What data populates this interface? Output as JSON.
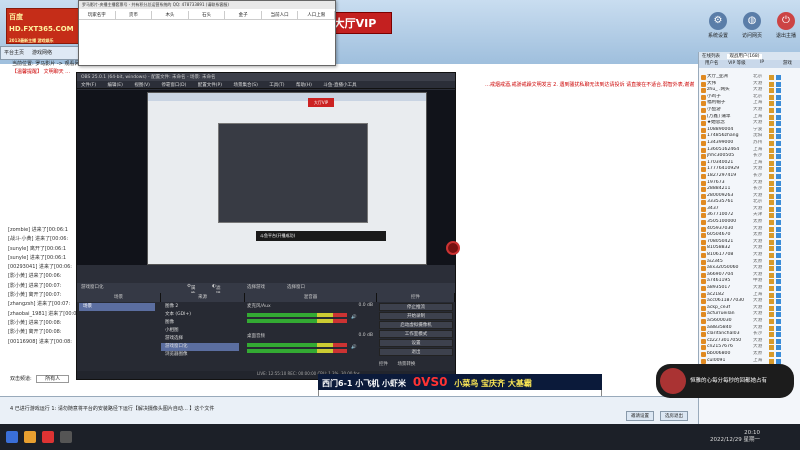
{
  "window": {
    "title": "多玩美女主播平台 4.3.0 经典版 正式版"
  },
  "logo": {
    "line1": "百度",
    "line2": "HD.FXT365.COM",
    "line3": "2013最新主播 游戏娱乐"
  },
  "header": {
    "vip_banner": "大厅VIP",
    "buttons": [
      {
        "label": "系统设置",
        "icon": "gear-icon"
      },
      {
        "label": "访问网页",
        "icon": "globe-icon"
      },
      {
        "label": "退出主播",
        "icon": "exit-icon"
      }
    ]
  },
  "left_tabs": [
    "平台主页",
    "游戏网络"
  ],
  "popup": {
    "title": "罗马影片-央播主播套票号 - 共有积分总运营系统的  QQ: 478733891 (请联系客服)",
    "columns": [
      "玩家名字",
      "货币",
      "木头",
      "石头",
      "金子",
      "当前人口",
      "人口上限"
    ]
  },
  "announcement": {
    "left": "【温馨提醒】 文明聊天 …",
    "right": "…戒烟戒酒,戒骄戒躁文明发言  2. 遇到骚扰私聊无法到达请投诉  请直接在不适合,弱智外表,谢谢"
  },
  "breadcrumb": "当前位置: 罗马影片 -> 观看网",
  "chat_log": [
    "[zombie] 进来了[00:06:1",
    "[战斗·小黄] 进来了[00:06:",
    "[sunyle] 离开了[00:06:1",
    "[sunyle] 进来了[00:06:1",
    "[00293041] 进来了[00:06:",
    "[影小黄] 进来了[00:06:",
    "[影小黄] 进来了[00:07:",
    "[影小黄] 离开了[00:07:",
    "[zhangzsh] 进来了[00:07:",
    "[zhaobai_1981] 进来了[00:08",
    "[影小黄] 进来了[00:08:",
    "[影小黄] 离开了[00:08:",
    "[00116908] 进来了[00:08:"
  ],
  "chat_input": {
    "label": "双击频道:",
    "value": "所有人"
  },
  "footer": {
    "tip": "4 已进行游戏运行   1: 请勿随意将平台的安装路径下运行【解决摄像头图片自动… 】这个文件",
    "buttons": [
      "邀请设置",
      "选房退出"
    ]
  },
  "obs": {
    "title": "OBS 25.0.1 (64-bit, windows) - 配置文件: 未命名 - 场景: 未命名",
    "menu": [
      "文件(F)",
      "编辑(E)",
      "视图(V)",
      "停靠窗口(D)",
      "配置文件(P)",
      "场景集合(S)",
      "工具(T)",
      "帮助(H)",
      "斗鱼-直播小工具"
    ],
    "preview_red": "大厅VIP",
    "preview_caption": "斗鱼平台(开播成功)",
    "controls_left": "游戏窗口化",
    "controls_items": [
      "属性",
      "滤镜",
      "选择游戏",
      "选择窗口"
    ],
    "panels": [
      "场景",
      "来源",
      "混音器",
      "控件"
    ],
    "scene": "场景",
    "sources": [
      "图像 2",
      "文本 (GDI+)",
      "图像",
      "小相图",
      "游戏选择",
      "游戏窗口化",
      "浏览器图像"
    ],
    "mixer": [
      {
        "name": "麦克风/Aux",
        "db": "0.0 dB"
      },
      {
        "name": "桌面音频",
        "db": "0.0 dB"
      }
    ],
    "controls": [
      "停止推流",
      "开始录制",
      "启动虚拟摄像机",
      "工作室模式",
      "设置",
      "退出"
    ],
    "controls_tabs": [
      "控件",
      "场景转换"
    ],
    "status": "LIVE: 12:55:10   REC: 00:00:00   CPU: 1.3%, 30.00 fps"
  },
  "ticker": {
    "left": "西门6-1 小飞机 小虾米",
    "score": "0VS0",
    "right": "小菜鸟 宝庆齐 大基霸"
  },
  "notification": {
    "text": "恒雅的心每分每秒的回都她占有"
  },
  "right_panel": {
    "tabs": [
      "在线列表",
      "观战用户(168)"
    ],
    "columns": [
      "用户名",
      "VIP 等级",
      "IP",
      "游戏"
    ],
    "users": [
      {
        "name": "大厅_亚洲",
        "loc": "北京"
      },
      {
        "name": "大伟",
        "loc": "大港"
      },
      {
        "name": "zhu_ .网头",
        "loc": "大港"
      },
      {
        "name": "小鸡子",
        "loc": "北京"
      },
      {
        "name": "福利帽子",
        "loc": "上海"
      },
      {
        "name": "小鱼游",
        "loc": "大港"
      },
      {
        "name": "[万鑫] 蒲苹",
        "loc": "上海"
      },
      {
        "name": "★她思念",
        "loc": "大港"
      },
      {
        "name": "108890004",
        "loc": "宁波"
      },
      {
        "name": "174856zhang",
        "loc": "沈阳"
      },
      {
        "name": "134399000",
        "loc": "苏州"
      },
      {
        "name": "13605162464",
        "loc": "上海"
      },
      {
        "name": "jhhc300505",
        "loc": "长沙"
      },
      {
        "name": "170340021",
        "loc": "上海"
      },
      {
        "name": "17776410929",
        "loc": "大港"
      },
      {
        "name": "1827297419",
        "loc": "长沙"
      },
      {
        "name": "197673",
        "loc": "大港"
      },
      {
        "name": "28884211",
        "loc": "长沙"
      },
      {
        "name": "280009263",
        "loc": "大港"
      },
      {
        "name": "333535761",
        "loc": "北京"
      },
      {
        "name": "3437",
        "loc": "大港"
      },
      {
        "name": "367710072",
        "loc": "天津"
      },
      {
        "name": "3505100000",
        "loc": "太原"
      },
      {
        "name": "405937030",
        "loc": "大港"
      },
      {
        "name": "60504670",
        "loc": "太原"
      },
      {
        "name": "708050421",
        "loc": "大港"
      },
      {
        "name": "81058832",
        "loc": "大港"
      },
      {
        "name": "810617708",
        "loc": "大港"
      },
      {
        "name": "ai2345",
        "loc": "太原"
      },
      {
        "name": "alix32050060",
        "loc": "大港"
      },
      {
        "name": "a66907704",
        "loc": "大港"
      },
      {
        "name": "a7461195",
        "loc": "中港"
      },
      {
        "name": "a8935017",
        "loc": "大港"
      },
      {
        "name": "ac2182",
        "loc": "上海"
      },
      {
        "name": "acc0611877030",
        "loc": "大港"
      },
      {
        "name": "ackp_ce3f",
        "loc": "大港"
      },
      {
        "name": "acfurrueilan",
        "loc": "大港"
      },
      {
        "name": "ai5600030",
        "loc": "大港"
      },
      {
        "name": "ai8835840",
        "loc": "大港"
      },
      {
        "name": "clarifanchal03",
        "loc": "长沙"
      },
      {
        "name": "cz2273017050",
        "loc": "大港"
      },
      {
        "name": "cn2157676",
        "loc": "大港"
      },
      {
        "name": "bb006800",
        "loc": "太原"
      },
      {
        "name": "cul0091",
        "loc": "上海"
      },
      {
        "name": "hsky_c9a",
        "loc": "大港"
      },
      {
        "name": "bonkr_0001",
        "loc": "大港"
      },
      {
        "name": "bz2005",
        "loc": "大港"
      },
      {
        "name": "mhr0000",
        "loc": "上海"
      }
    ]
  },
  "taskbar": {
    "time": "20:10",
    "date": "2022/12/29 星期一"
  },
  "colors": {
    "accent": "#c42020",
    "obs_bg": "#2b2e38",
    "panel_bg": "#f3f6fa"
  }
}
